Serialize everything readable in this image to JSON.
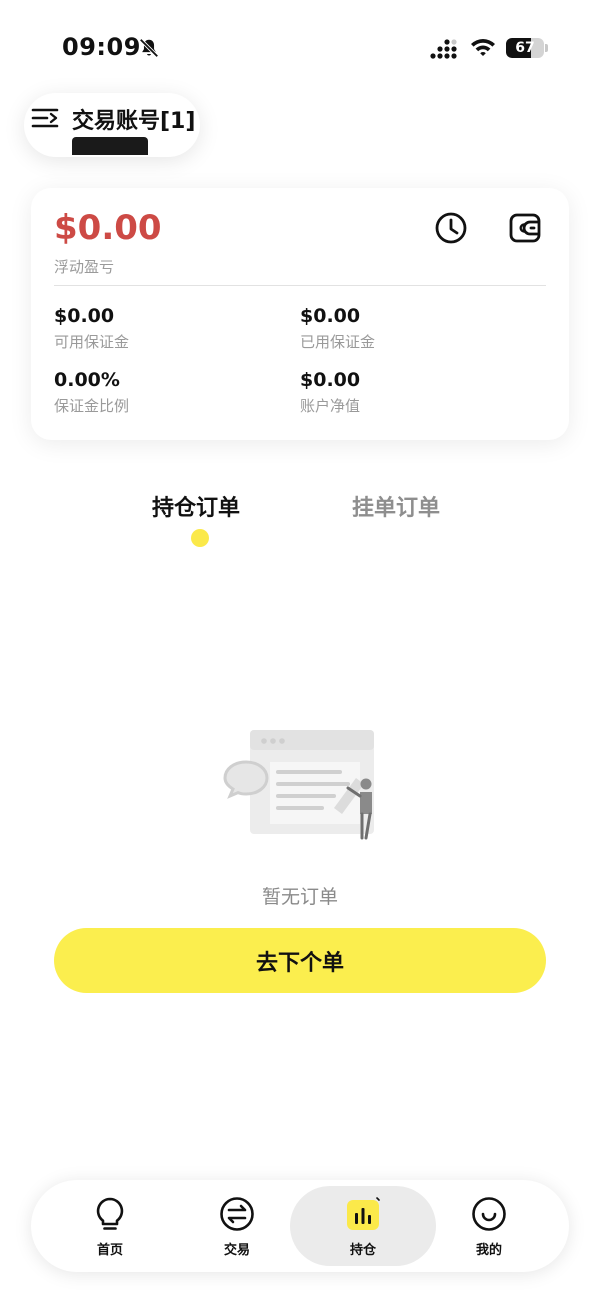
{
  "status_bar": {
    "time": "09:09",
    "battery_level": "67",
    "icons": [
      "bell-slash-icon",
      "signal-icon",
      "wifi-icon",
      "battery-icon"
    ]
  },
  "header": {
    "menu_icon": "menu-indent-icon",
    "account_title": "交易账号[1]"
  },
  "summary": {
    "floating_pnl_value": "$0.00",
    "floating_pnl_label": "浮动盈亏",
    "pnl_color": "#cd4a45",
    "history_icon": "clock-icon",
    "wallet_icon": "wallet-icon",
    "metrics": [
      {
        "value": "$0.00",
        "label": "可用保证金"
      },
      {
        "value": "$0.00",
        "label": "已用保证金"
      },
      {
        "value": "0.00%",
        "label": "保证金比例"
      },
      {
        "value": "$0.00",
        "label": "账户净值"
      }
    ]
  },
  "tabs": [
    {
      "label": "持仓订单",
      "active": true
    },
    {
      "label": "挂单订单",
      "active": false
    }
  ],
  "empty_state": {
    "illustration": "empty-orders-illustration",
    "text": "暂无订单",
    "button_label": "去下个单",
    "accent_color": "#fbee4e"
  },
  "bottom_nav": [
    {
      "label": "首页",
      "icon": "lightbulb-icon",
      "active": false
    },
    {
      "label": "交易",
      "icon": "exchange-icon",
      "active": false
    },
    {
      "label": "持仓",
      "icon": "bar-chart-icon",
      "active": true
    },
    {
      "label": "我的",
      "icon": "smile-icon",
      "active": false
    }
  ]
}
